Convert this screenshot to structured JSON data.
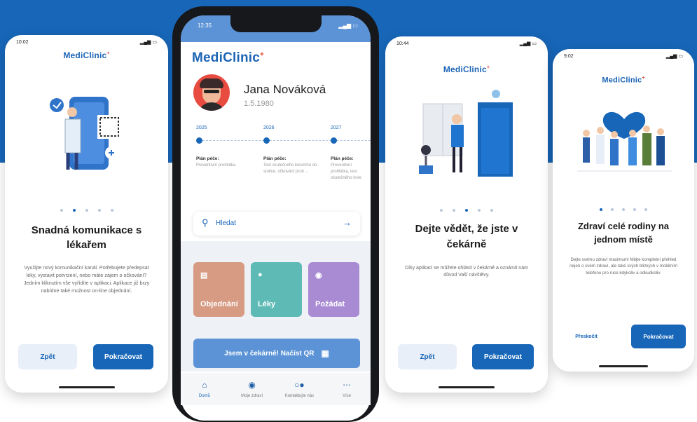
{
  "brand": {
    "name": "MediClinic",
    "mark": "+",
    "primary": "#1766b8",
    "background_band": "#1766b8"
  },
  "screen1": {
    "time": "10:02",
    "title": "Snadná komunikace s lékařem",
    "body": "Využijte nový komunikační kanál. Potřebujete předepsat léky, vystavit potvrzení, nebo máte zájem o očkování? Jedním kliknutím vše vyřídíte v aplikaci. Aplikace již brzy nabídne také možnost on-line objednání.",
    "back_label": "Zpět",
    "continue_label": "Pokračovat"
  },
  "screen_main": {
    "time": "12:35",
    "user_name": "Jana Nováková",
    "birth_date": "1.5.1980",
    "timeline": [
      {
        "year": "2025",
        "title": "Plán péče:",
        "text": "Preventivní prohlídka"
      },
      {
        "year": "2026",
        "title": "Plán péče:",
        "text": "Test skutečného krevního do stolice, očkování proti ..."
      },
      {
        "year": "2027",
        "title": "Plán péče:",
        "text": "Preventivní prohlídka, test skutečného krve"
      }
    ],
    "search_placeholder": "Hledat",
    "tiles": [
      {
        "label": "Objednání",
        "color": "#d79a83",
        "icon": "calendar-icon"
      },
      {
        "label": "Léky",
        "color": "#5dbab5",
        "icon": "pills-icon"
      },
      {
        "label": "Požádat",
        "color": "#a98bd4",
        "icon": "chat-icon"
      }
    ],
    "cta_label": "Jsem v čekárně! Načíst QR",
    "nav": [
      {
        "label": "Domů",
        "icon": "home-icon"
      },
      {
        "label": "Moje zdraví",
        "icon": "health-icon"
      },
      {
        "label": "Kontaktujte nás",
        "icon": "contact-icon"
      },
      {
        "label": "Více",
        "icon": "more-icon"
      }
    ]
  },
  "screen3": {
    "time": "10:44",
    "title": "Dejte vědět, že jste v čekárně",
    "body": "Díky aplikaci se můžete ohlásit v čekárně a oznámit nám důvod Vaší návštěvy.",
    "back_label": "Zpět",
    "continue_label": "Pokračovat"
  },
  "screen4": {
    "time": "9:02",
    "title": "Zdraví celé rodiny na jednom místě",
    "body": "Dejte svému zdraví maximum! Mějte kompletní přehled nejen o svém zdraví, ale také svých blízkých v mobilním telefonu pro ruce kdykoliv a odkudkoliv.",
    "skip_label": "Přeskočit",
    "continue_label": "Pokračovat"
  }
}
